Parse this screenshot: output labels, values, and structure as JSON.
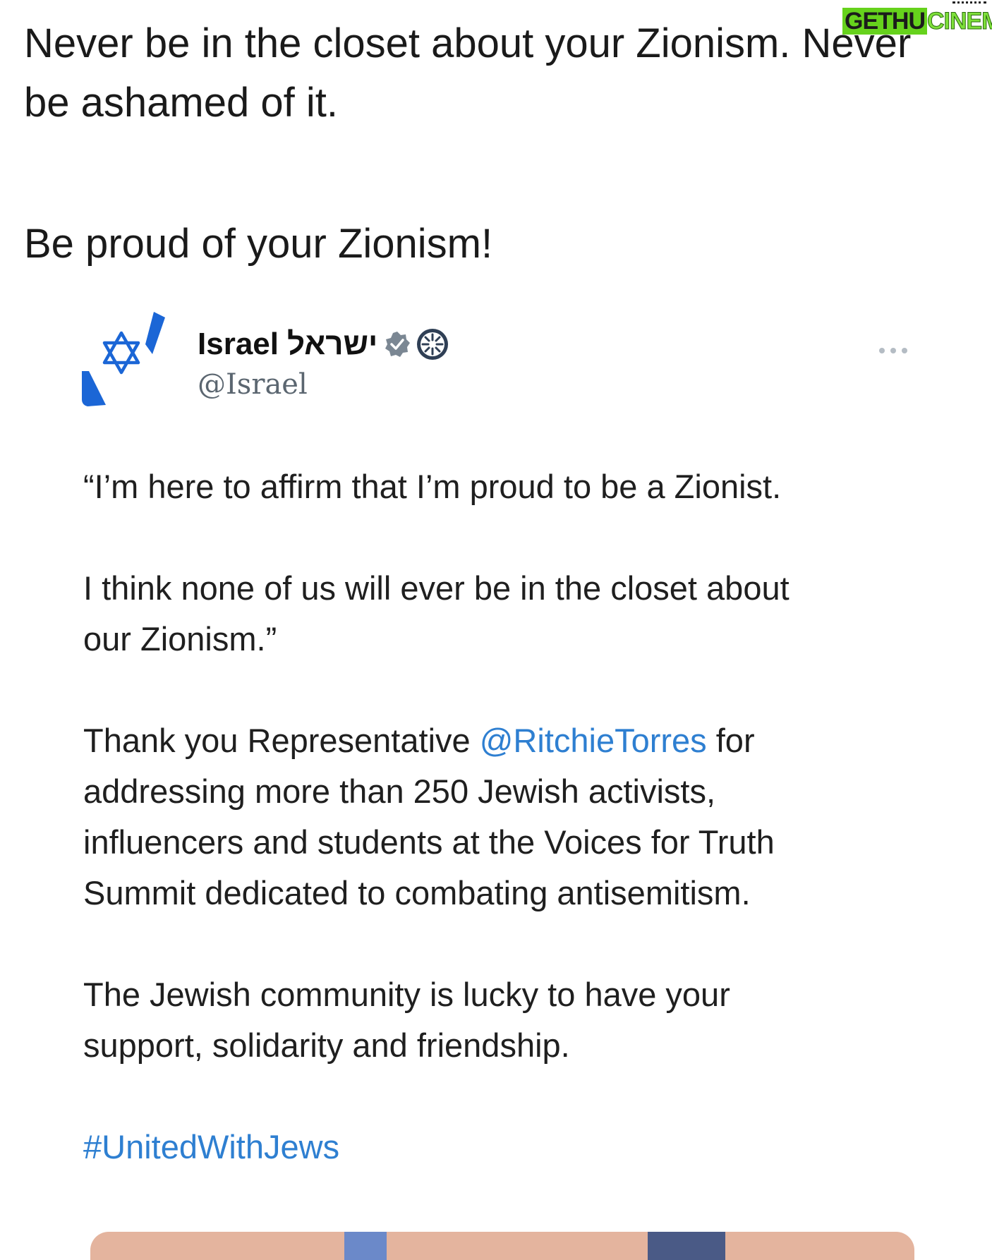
{
  "caption": {
    "line1": "Never be in the closet about your Zionism.  Never",
    "line2": "be ashamed of it.",
    "line3": "Be proud of your Zionism!"
  },
  "watermark": {
    "part1": "GETHU",
    "part2": "CINEMA"
  },
  "tweet": {
    "author": {
      "display_name": "Israel",
      "hebrew_name": "ישראל",
      "handle": "@Israel",
      "brand_color": "#1b66d6"
    },
    "more_label": "•••",
    "body": {
      "quote_line1": "“I’m here to affirm that I’m proud to be a Zionist.",
      "quote_line2": "I think none of us will ever be in the closet about",
      "quote_line3": "our Zionism.”",
      "thanks_prefix": "Thank you Representative ",
      "mention": "@RitchieTorres",
      "thanks_suffix": " for",
      "thanks_line2": "addressing more than 250 Jewish activists,",
      "thanks_line3": "influencers and students at the Voices for Truth",
      "thanks_line4": "Summit dedicated to combating antisemitism.",
      "closing_line1": "The Jewish community is lucky to have your",
      "closing_line2": "support, solidarity and friendship.",
      "hashtag": "#UnitedWithJews"
    },
    "link_color": "#2e7fd1"
  }
}
